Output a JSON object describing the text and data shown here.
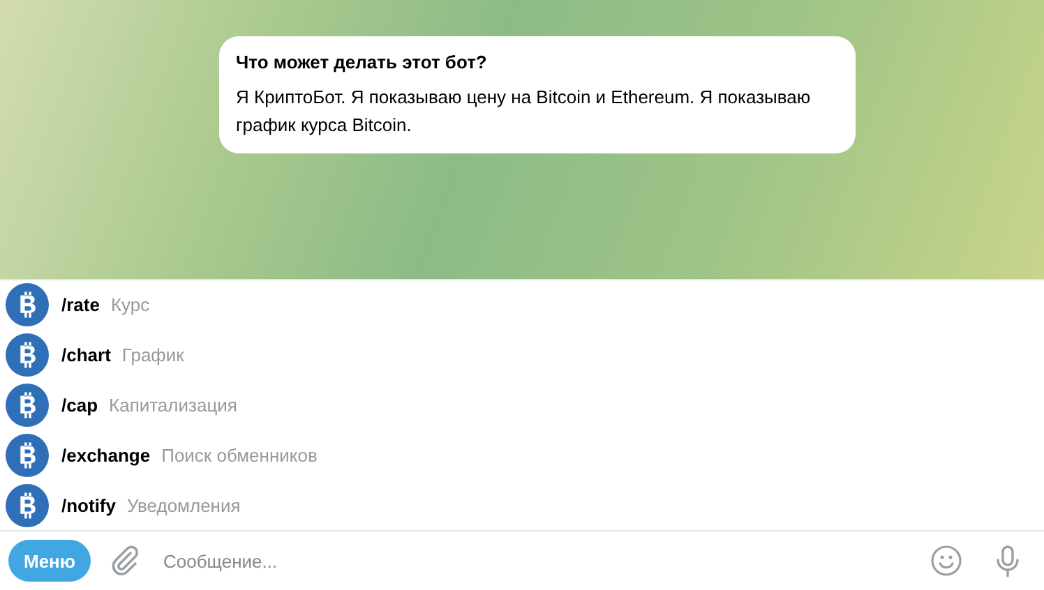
{
  "info_bubble": {
    "title": "Что может делать этот бот?",
    "text": "Я КриптоБот. Я показываю цену на Bitcoin и Ethereum. Я показываю график курса Bitcoin."
  },
  "commands": [
    {
      "command": "/rate",
      "description": "Курс"
    },
    {
      "command": "/chart",
      "description": "График"
    },
    {
      "command": "/cap",
      "description": "Капитализация"
    },
    {
      "command": "/exchange",
      "description": "Поиск обменников"
    },
    {
      "command": "/notify",
      "description": "Уведомления"
    }
  ],
  "composer": {
    "menu_button": "Меню",
    "placeholder": "Сообщение..."
  }
}
